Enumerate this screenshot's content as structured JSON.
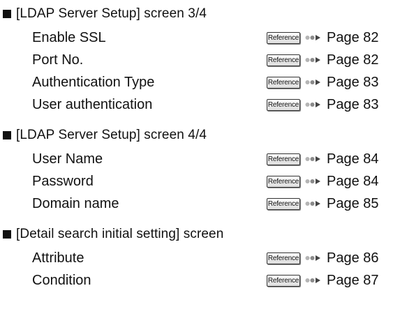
{
  "sections": [
    {
      "heading": "[LDAP Server Setup] screen 3/4",
      "items": [
        {
          "label": "Enable SSL",
          "ref": "Reference",
          "page": "Page 82"
        },
        {
          "label": "Port No.",
          "ref": "Reference",
          "page": "Page 82"
        },
        {
          "label": "Authentication Type",
          "ref": "Reference",
          "page": "Page 83"
        },
        {
          "label": "User authentication",
          "ref": "Reference",
          "page": "Page 83"
        }
      ]
    },
    {
      "heading": "[LDAP Server Setup] screen 4/4",
      "items": [
        {
          "label": "User Name",
          "ref": "Reference",
          "page": "Page 84"
        },
        {
          "label": "Password",
          "ref": "Reference",
          "page": "Page 84"
        },
        {
          "label": "Domain name",
          "ref": "Reference",
          "page": "Page 85"
        }
      ]
    },
    {
      "heading": "[Detail search initial setting] screen",
      "items": [
        {
          "label": "Attribute",
          "ref": "Reference",
          "page": "Page 86"
        },
        {
          "label": "Condition",
          "ref": "Reference",
          "page": "Page 87"
        }
      ]
    }
  ]
}
